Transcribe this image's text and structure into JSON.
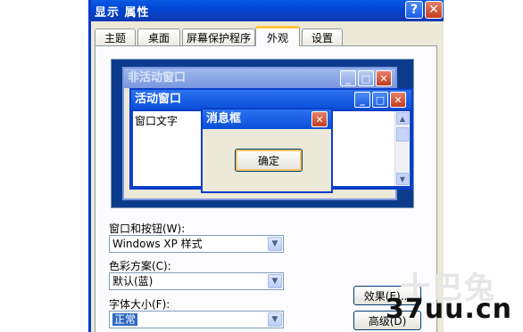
{
  "window": {
    "title": "显示 属性",
    "help_label": "?",
    "close_label": "✕"
  },
  "tabs": [
    {
      "label": "主题"
    },
    {
      "label": "桌面"
    },
    {
      "label": "屏幕保护程序"
    },
    {
      "label": "外观",
      "active": true
    },
    {
      "label": "设置"
    }
  ],
  "preview": {
    "inactive_title": "非活动窗口",
    "active_title": "活动窗口",
    "window_text": "窗口文字",
    "msgbox_title": "消息框",
    "ok_label": "确定"
  },
  "fields": {
    "windows_buttons": {
      "label": "窗口和按钮(W):",
      "value": "Windows XP 样式"
    },
    "color_scheme": {
      "label": "色彩方案(C):",
      "value": "默认(蓝)"
    },
    "font_size": {
      "label": "字体大小(F):",
      "value": "正常"
    }
  },
  "buttons": {
    "effects": "效果(E)...",
    "advanced": "高级(D)"
  },
  "watermark": {
    "light": "十巴兔",
    "main": "37uu.cn"
  }
}
